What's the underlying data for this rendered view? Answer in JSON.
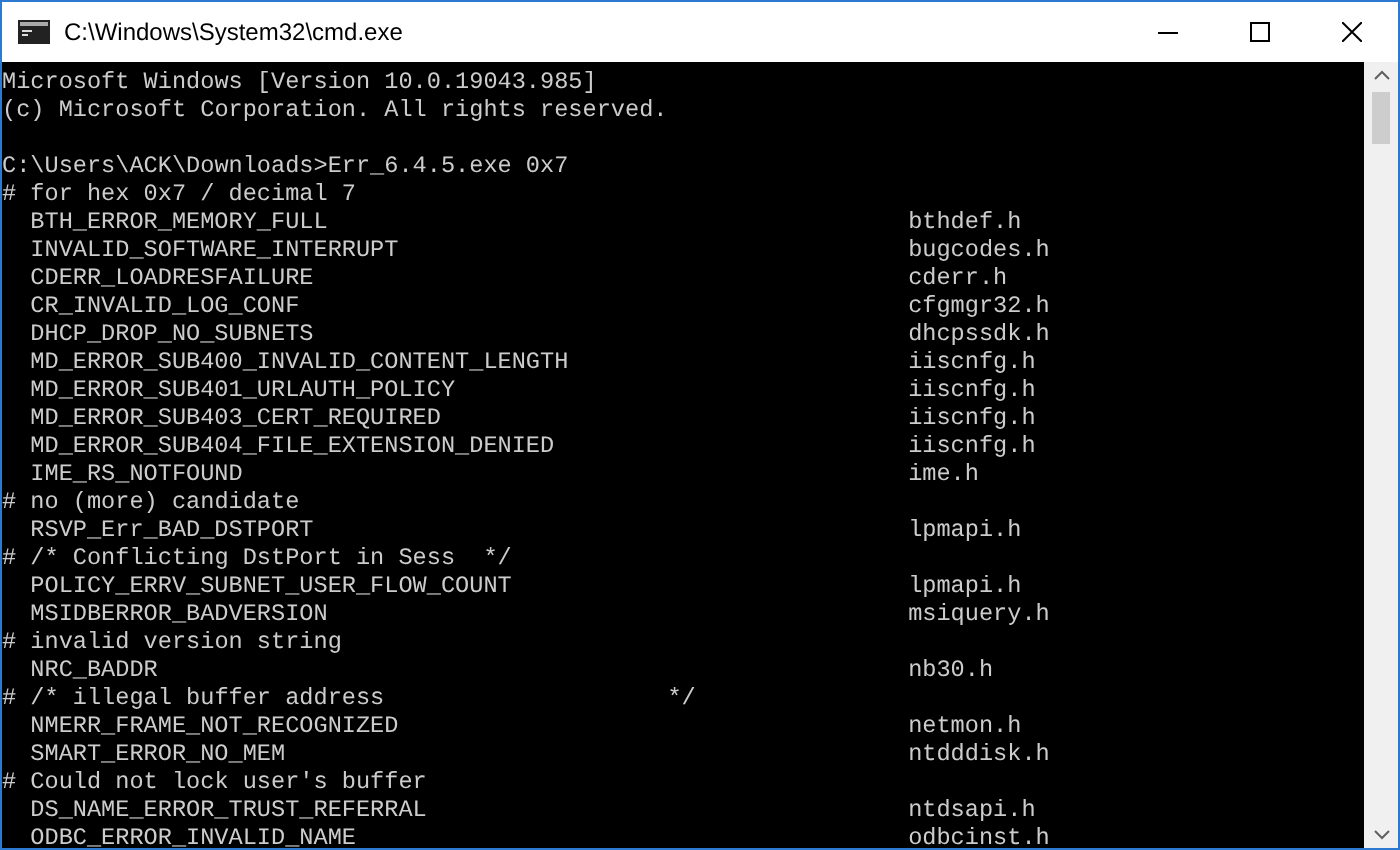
{
  "window": {
    "title": "C:\\Windows\\System32\\cmd.exe"
  },
  "lines": [
    {
      "kind": "text",
      "text": "Microsoft Windows [Version 10.0.19043.985]"
    },
    {
      "kind": "text",
      "text": "(c) Microsoft Corporation. All rights reserved."
    },
    {
      "kind": "blank"
    },
    {
      "kind": "text",
      "text": "C:\\Users\\ACK\\Downloads>Err_6.4.5.exe 0x7"
    },
    {
      "kind": "text",
      "text": "# for hex 0x7 / decimal 7"
    },
    {
      "kind": "entry",
      "name": "BTH_ERROR_MEMORY_FULL",
      "header": "bthdef.h"
    },
    {
      "kind": "entry",
      "name": "INVALID_SOFTWARE_INTERRUPT",
      "header": "bugcodes.h"
    },
    {
      "kind": "entry",
      "name": "CDERR_LOADRESFAILURE",
      "header": "cderr.h"
    },
    {
      "kind": "entry",
      "name": "CR_INVALID_LOG_CONF",
      "header": "cfgmgr32.h"
    },
    {
      "kind": "entry",
      "name": "DHCP_DROP_NO_SUBNETS",
      "header": "dhcpssdk.h"
    },
    {
      "kind": "entry",
      "name": "MD_ERROR_SUB400_INVALID_CONTENT_LENGTH",
      "header": "iiscnfg.h"
    },
    {
      "kind": "entry",
      "name": "MD_ERROR_SUB401_URLAUTH_POLICY",
      "header": "iiscnfg.h"
    },
    {
      "kind": "entry",
      "name": "MD_ERROR_SUB403_CERT_REQUIRED",
      "header": "iiscnfg.h"
    },
    {
      "kind": "entry",
      "name": "MD_ERROR_SUB404_FILE_EXTENSION_DENIED",
      "header": "iiscnfg.h"
    },
    {
      "kind": "entry",
      "name": "IME_RS_NOTFOUND",
      "header": "ime.h"
    },
    {
      "kind": "text",
      "text": "# no (more) candidate"
    },
    {
      "kind": "entry",
      "name": "RSVP_Err_BAD_DSTPORT",
      "header": "lpmapi.h"
    },
    {
      "kind": "text",
      "text": "# /* Conflicting DstPort in Sess  */"
    },
    {
      "kind": "entry",
      "name": "POLICY_ERRV_SUBNET_USER_FLOW_COUNT",
      "header": "lpmapi.h"
    },
    {
      "kind": "entry",
      "name": "MSIDBERROR_BADVERSION",
      "header": "msiquery.h"
    },
    {
      "kind": "text",
      "text": "# invalid version string"
    },
    {
      "kind": "entry",
      "name": "NRC_BADDR",
      "header": "nb30.h"
    },
    {
      "kind": "text",
      "text": "# /* illegal buffer address                    */"
    },
    {
      "kind": "entry",
      "name": "NMERR_FRAME_NOT_RECOGNIZED",
      "header": "netmon.h"
    },
    {
      "kind": "entry",
      "name": "SMART_ERROR_NO_MEM",
      "header": "ntdddisk.h"
    },
    {
      "kind": "text",
      "text": "# Could not lock user's buffer"
    },
    {
      "kind": "entry",
      "name": "DS_NAME_ERROR_TRUST_REFERRAL",
      "header": "ntdsapi.h"
    },
    {
      "kind": "entry",
      "name": "ODBC_ERROR_INVALID_NAME",
      "header": "odbcinst.h"
    }
  ]
}
